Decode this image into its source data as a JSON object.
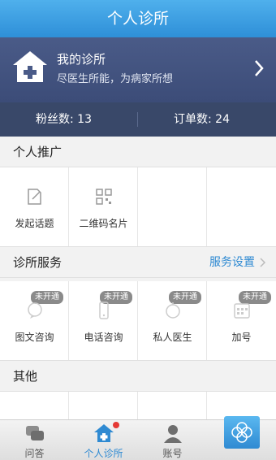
{
  "header": {
    "title": "个人诊所"
  },
  "clinic": {
    "title": "我的诊所",
    "subtitle": "尽医生所能，为病家所想"
  },
  "stats": {
    "fans": "粉丝数: 13",
    "orders": "订单数: 24"
  },
  "promotion": {
    "title": "个人推广",
    "items": [
      {
        "label": "发起话题",
        "icon": "edit-icon"
      },
      {
        "label": "二维码名片",
        "icon": "qrcode-icon"
      }
    ]
  },
  "services": {
    "title": "诊所服务",
    "settings_label": "服务设置",
    "items": [
      {
        "label": "图文咨询",
        "badge": "未开通",
        "icon": "chat-bubble-icon"
      },
      {
        "label": "电话咨询",
        "badge": "未开通",
        "icon": "phone-icon"
      },
      {
        "label": "私人医生",
        "badge": "未开通",
        "icon": "doctor-icon"
      },
      {
        "label": "加号",
        "badge": "未开通",
        "icon": "calendar-grid-icon"
      }
    ]
  },
  "other": {
    "title": "其他"
  },
  "tabbar": {
    "tabs": [
      {
        "label": "问答",
        "icon": "chat-icon"
      },
      {
        "label": "个人诊所",
        "icon": "clinic-icon",
        "active": true
      },
      {
        "label": "账号",
        "icon": "user-icon"
      }
    ],
    "special_icon": "clover-icon"
  },
  "colors": {
    "primary": "#2f8ad2",
    "hero": "#4a5b88",
    "stats": "#394869"
  }
}
